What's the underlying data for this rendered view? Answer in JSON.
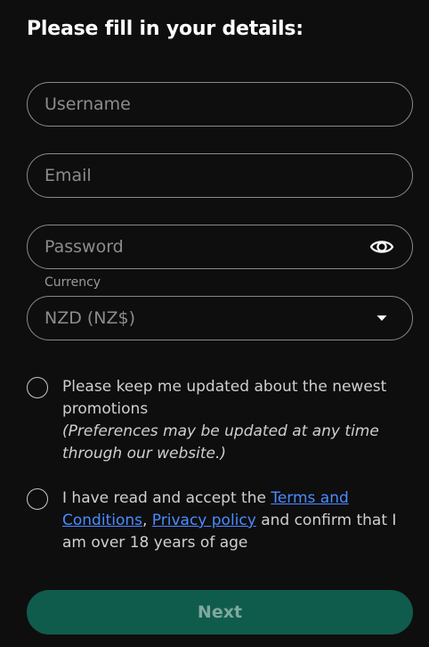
{
  "form": {
    "title": "Please fill in your details:",
    "username": {
      "placeholder": "Username",
      "value": ""
    },
    "email": {
      "placeholder": "Email",
      "value": ""
    },
    "password": {
      "placeholder": "Password",
      "value": "",
      "toggle_icon": "eye-icon"
    },
    "currency": {
      "label": "Currency",
      "selected": "NZD (NZ$)",
      "icon": "caret-down-icon"
    },
    "promotions": {
      "text": "Please keep me updated about the newest promotions",
      "note": "(Preferences may be updated at any time through our website.)",
      "checked": false
    },
    "terms": {
      "prefix": "I have read and accept the ",
      "terms_link": "Terms and Conditions",
      "separator": ", ",
      "privacy_link": "Privacy policy",
      "suffix": " and confirm that I am over 18 years of age",
      "checked": false
    },
    "next_label": "Next"
  },
  "colors": {
    "background": "#0e0e0e",
    "button": "#105c4c",
    "link": "#4b8bff",
    "border": "#8a8a8a"
  }
}
